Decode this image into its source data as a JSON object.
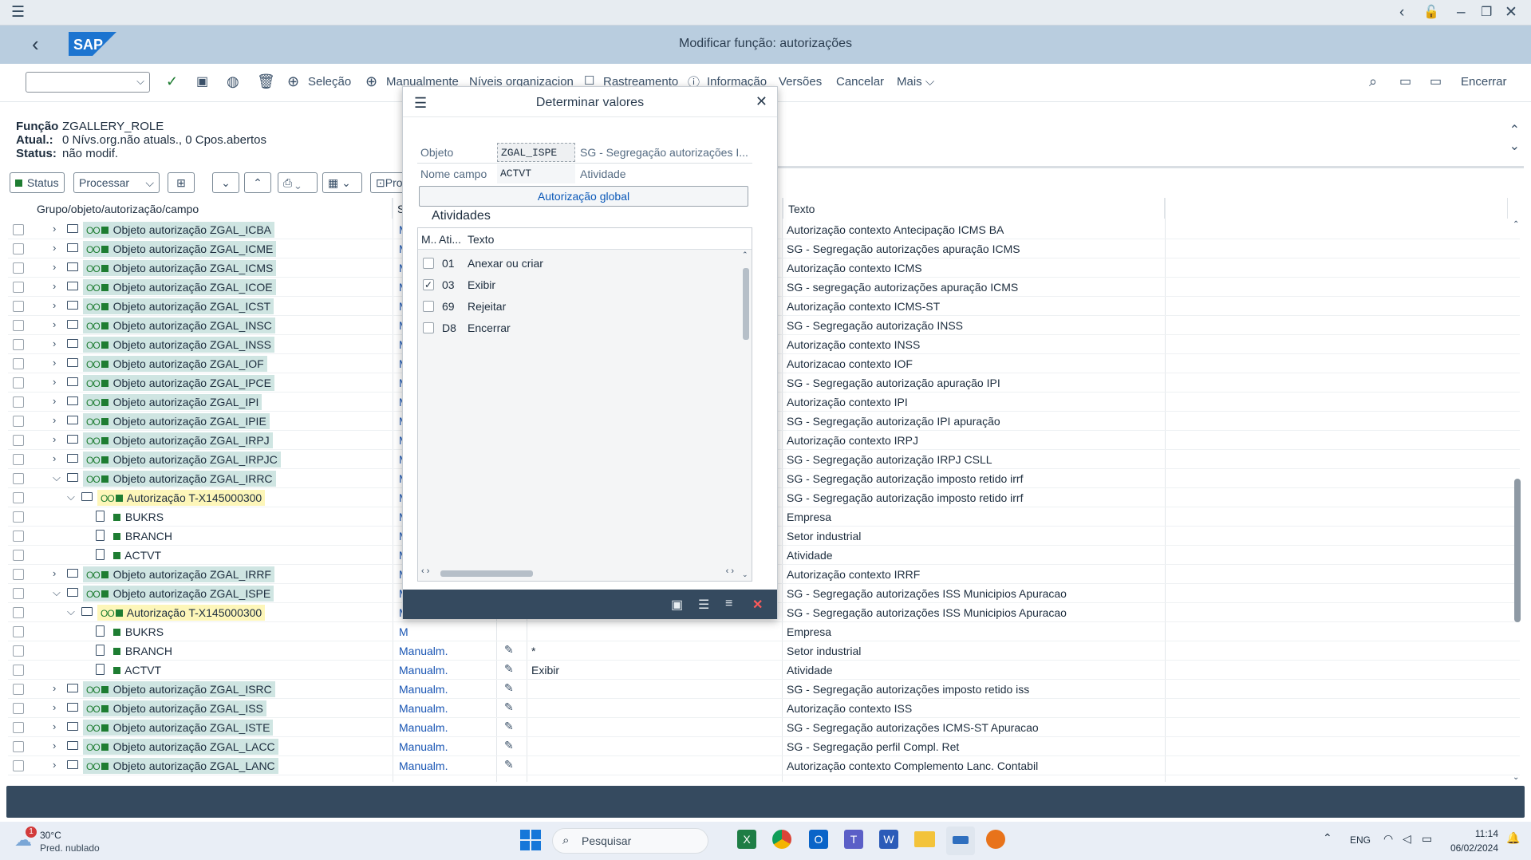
{
  "window": {
    "title": "Modificar função: autorizações"
  },
  "toolbar": {
    "seleção": "Seleção",
    "manualmente": "Manualmente",
    "niveis": "Níveis organizacion",
    "rastreamento": "Rastreamento",
    "informacao": "Informação",
    "versoes": "Versões",
    "cancelar": "Cancelar",
    "mais": "Mais",
    "encerrar": "Encerrar"
  },
  "info": {
    "funcao_label": "Função",
    "funcao_value": "ZGALLERY_ROLE",
    "atual_label": "Atual.:",
    "atual_value": "0 Nívs.org.não atuals., 0 Cpos.abertos",
    "status_label": "Status:",
    "status_value": "não modif."
  },
  "grid_toolbar": {
    "status": "Status",
    "processar": "Processar",
    "pro": "Pro"
  },
  "grid": {
    "columns": {
      "group": "Grupo/objeto/autorização/campo",
      "s": "S",
      "texto": "Texto"
    },
    "rows": [
      {
        "label": "Objeto autorização ZGAL_ICBA",
        "s": "M",
        "text": "Autorização contexto Antecipação ICMS BA"
      },
      {
        "label": "Objeto autorização ZGAL_ICME",
        "s": "M",
        "text": "SG - Segregação autorizações apuração ICMS"
      },
      {
        "label": "Objeto autorização ZGAL_ICMS",
        "s": "M",
        "text": "Autorização contexto ICMS"
      },
      {
        "label": "Objeto autorização ZGAL_ICOE",
        "s": "M",
        "text": "SG - segregação autorizações apuração ICMS"
      },
      {
        "label": "Objeto autorização ZGAL_ICST",
        "s": "M",
        "text": "Autorização contexto ICMS-ST"
      },
      {
        "label": "Objeto autorização ZGAL_INSC",
        "s": "M",
        "text": "SG - Segregação autorização INSS"
      },
      {
        "label": "Objeto autorização ZGAL_INSS",
        "s": "M",
        "text": "Autorização contexto INSS"
      },
      {
        "label": "Objeto autorização ZGAL_IOF",
        "s": "M",
        "text": "Autorizacao contexto IOF"
      },
      {
        "label": "Objeto autorização ZGAL_IPCE",
        "s": "M",
        "text": "SG - Segregação autorização apuração IPI"
      },
      {
        "label": "Objeto autorização ZGAL_IPI",
        "s": "M",
        "text": "Autorização contexto IPI"
      },
      {
        "label": "Objeto autorização ZGAL_IPIE",
        "s": "M",
        "text": "SG - Segregação autorização IPI apuração"
      },
      {
        "label": "Objeto autorização ZGAL_IRPJ",
        "s": "M",
        "text": "Autorização contexto IRPJ"
      },
      {
        "label": "Objeto autorização ZGAL_IRPJC",
        "s": "M",
        "text": "SG - Segregação autorização IRPJ CSLL"
      },
      {
        "label": "Objeto autorização ZGAL_IRRC",
        "s": "M",
        "text": "SG - Segregação autorização imposto retido irrf"
      },
      {
        "label": "Autorização T-X145000300",
        "s": "M",
        "text": "SG - Segregação autorização imposto retido irrf"
      },
      {
        "label": "BUKRS",
        "s": "M",
        "text": "Empresa"
      },
      {
        "label": "BRANCH",
        "s": "M",
        "text": "Setor industrial"
      },
      {
        "label": "ACTVT",
        "s": "M",
        "text": "Atividade"
      },
      {
        "label": "Objeto autorização ZGAL_IRRF",
        "s": "M",
        "text": "Autorização contexto IRRF"
      },
      {
        "label": "Objeto autorização ZGAL_ISPE",
        "s": "M",
        "text": "SG - Segregação autorizações ISS Municipios Apuracao"
      },
      {
        "label": "Autorização T-X145000300",
        "s": "M",
        "text": "SG - Segregação autorizações ISS Municipios Apuracao"
      },
      {
        "label": "BUKRS",
        "s": "M",
        "text": "Empresa"
      },
      {
        "label": "BRANCH",
        "s": "Manualm.",
        "val": "*",
        "text": "Setor industrial"
      },
      {
        "label": "ACTVT",
        "s": "Manualm.",
        "val": "Exibir",
        "text": "Atividade"
      },
      {
        "label": "Objeto autorização ZGAL_ISRC",
        "s": "Manualm.",
        "text": "SG - Segregação autorizações imposto retido iss"
      },
      {
        "label": "Objeto autorização ZGAL_ISS",
        "s": "Manualm.",
        "text": "Autorização contexto ISS"
      },
      {
        "label": "Objeto autorização ZGAL_ISTE",
        "s": "Manualm.",
        "text": "SG - Segregação autorizações ICMS-ST Apuracao"
      },
      {
        "label": "Objeto autorização ZGAL_LACC",
        "s": "Manualm.",
        "text": "SG - Segregação perfil Compl. Ret"
      },
      {
        "label": "Objeto autorização ZGAL_LANC",
        "s": "Manualm.",
        "text": "Autorização contexto Complemento Lanc. Contabil"
      }
    ]
  },
  "dialog": {
    "title": "Determinar valores",
    "objeto_label": "Objeto",
    "objeto_value": "ZGAL_ISPE",
    "objeto_desc": "SG - Segregação autorizações I...",
    "campo_label": "Nome campo",
    "campo_value": "ACTVT",
    "campo_desc": "Atividade",
    "global_button": "Autorização global",
    "section": "Atividades",
    "cols": {
      "m": "M..",
      "ati": "Ati...",
      "texto": "Texto"
    },
    "activities": [
      {
        "code": "01",
        "text": "Anexar ou criar",
        "checked": false
      },
      {
        "code": "03",
        "text": "Exibir",
        "checked": true
      },
      {
        "code": "69",
        "text": "Rejeitar",
        "checked": false
      },
      {
        "code": "D8",
        "text": "Encerrar",
        "checked": false
      }
    ]
  },
  "taskbar": {
    "temp": "30°C",
    "weather": "Pred. nublado",
    "search": "Pesquisar",
    "lang": "ENG",
    "time": "11:14",
    "date": "06/02/2024",
    "badge": "1"
  },
  "colors": {
    "shell": "#b9cddf",
    "object_highlight": "#cfe5e2",
    "auth_highlight": "#fdf6b9",
    "status_bar": "#354a5f",
    "selection_box": "#1f2fa8"
  }
}
